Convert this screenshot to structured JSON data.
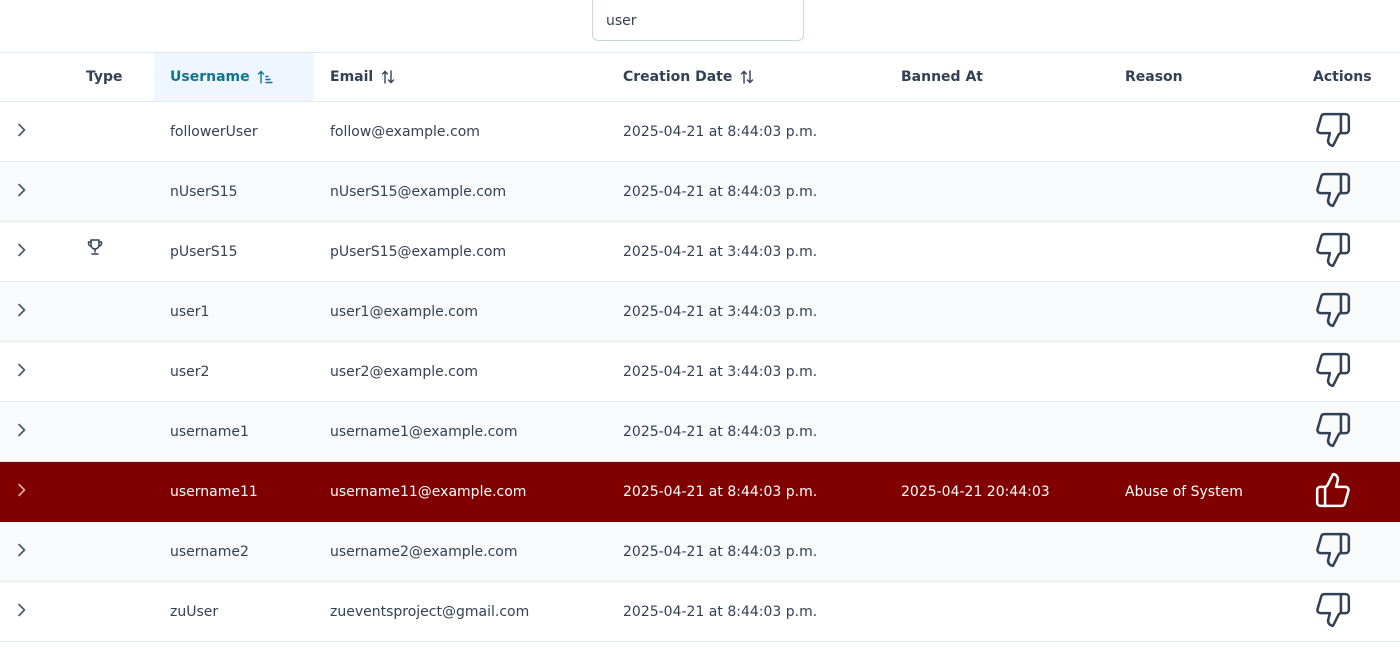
{
  "search": {
    "value": "user",
    "placeholder": ""
  },
  "table": {
    "columns": {
      "type": "Type",
      "username": "Username",
      "email": "Email",
      "creation_date": "Creation Date",
      "banned_at": "Banned At",
      "reason": "Reason",
      "actions": "Actions"
    },
    "sorted_column": "username",
    "sort_direction": "ascending",
    "colors": {
      "accent": "#0e7490",
      "banned_row": "#800000",
      "alt_row": "#f8fafc"
    },
    "rows": [
      {
        "type_icon": "",
        "username": "followerUser",
        "email": "follow@example.com",
        "creation_date": "2025-04-21 at 8:44:03 p.m.",
        "banned_at": "",
        "reason": "",
        "action_icon": "thumbs-down-icon",
        "banned": false
      },
      {
        "type_icon": "",
        "username": "nUserS15",
        "email": "nUserS15@example.com",
        "creation_date": "2025-04-21 at 8:44:03 p.m.",
        "banned_at": "",
        "reason": "",
        "action_icon": "thumbs-down-icon",
        "banned": false
      },
      {
        "type_icon": "trophy-icon",
        "username": "pUserS15",
        "email": "pUserS15@example.com",
        "creation_date": "2025-04-21 at 3:44:03 p.m.",
        "banned_at": "",
        "reason": "",
        "action_icon": "thumbs-down-icon",
        "banned": false
      },
      {
        "type_icon": "",
        "username": "user1",
        "email": "user1@example.com",
        "creation_date": "2025-04-21 at 3:44:03 p.m.",
        "banned_at": "",
        "reason": "",
        "action_icon": "thumbs-down-icon",
        "banned": false
      },
      {
        "type_icon": "",
        "username": "user2",
        "email": "user2@example.com",
        "creation_date": "2025-04-21 at 3:44:03 p.m.",
        "banned_at": "",
        "reason": "",
        "action_icon": "thumbs-down-icon",
        "banned": false
      },
      {
        "type_icon": "",
        "username": "username1",
        "email": "username1@example.com",
        "creation_date": "2025-04-21 at 8:44:03 p.m.",
        "banned_at": "",
        "reason": "",
        "action_icon": "thumbs-down-icon",
        "banned": false
      },
      {
        "type_icon": "",
        "username": "username11",
        "email": "username11@example.com",
        "creation_date": "2025-04-21 at 8:44:03 p.m.",
        "banned_at": "2025-04-21 20:44:03",
        "reason": "Abuse of System",
        "action_icon": "thumbs-up-icon",
        "banned": true
      },
      {
        "type_icon": "",
        "username": "username2",
        "email": "username2@example.com",
        "creation_date": "2025-04-21 at 8:44:03 p.m.",
        "banned_at": "",
        "reason": "",
        "action_icon": "thumbs-down-icon",
        "banned": false
      },
      {
        "type_icon": "",
        "username": "zuUser",
        "email": "zueventsproject@gmail.com",
        "creation_date": "2025-04-21 at 8:44:03 p.m.",
        "banned_at": "",
        "reason": "",
        "action_icon": "thumbs-down-icon",
        "banned": false
      }
    ]
  }
}
